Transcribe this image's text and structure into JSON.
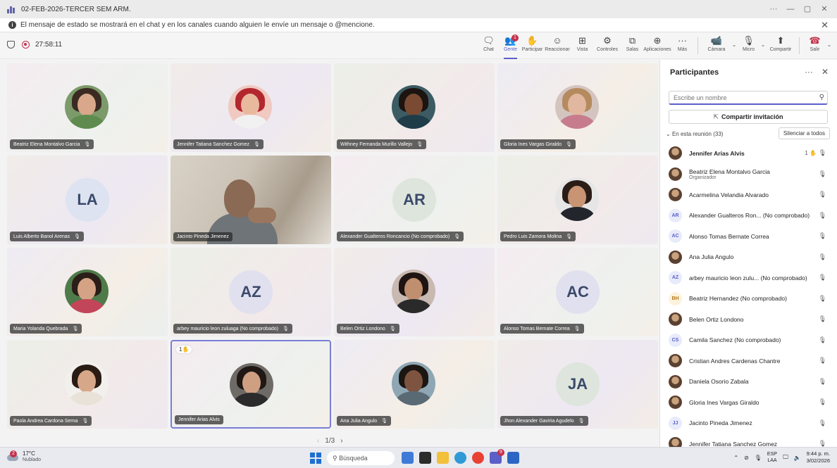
{
  "window": {
    "title": "02-FEB-2026-TERCER SEM ARM."
  },
  "banner": {
    "text": "El mensaje de estado se mostrará en el chat y en los canales cuando alguien le envíe un mensaje o @mencione."
  },
  "meeting": {
    "timer": "27:58:11"
  },
  "toolbar": {
    "chat": "Chat",
    "people": "Gente",
    "people_badge": "1",
    "join": "Participar",
    "react": "Reaccionar",
    "view": "Vista",
    "controls": "Controles",
    "rooms": "Salas",
    "apps": "Aplicaciones",
    "more": "Más",
    "camera": "Cámara",
    "mic": "Micro",
    "share": "Compartir",
    "leave": "Salir"
  },
  "tiles": [
    {
      "name": "Beatriz Elena Montalvo Garcia",
      "type": "photo"
    },
    {
      "name": "Jennifer Tatiana Sanchez Gomez",
      "type": "photo"
    },
    {
      "name": "Withney Fernanda Murillo Vallejo",
      "type": "photo"
    },
    {
      "name": "Gloria Ines Vargas Giraldo",
      "type": "photo"
    },
    {
      "name": "Luis Alberto Banol Arenas",
      "type": "initials",
      "initials": "LA"
    },
    {
      "name": "Jacinto Pineda Jimenez",
      "type": "video"
    },
    {
      "name": "Alexander Gualteros Roncancio (No comprobado)",
      "type": "initials",
      "initials": "AR"
    },
    {
      "name": "Pedro Luis Zamora Molina",
      "type": "photo"
    },
    {
      "name": "Maria Yolanda Quebrada",
      "type": "photo"
    },
    {
      "name": "arbey mauricio leon zuluaga (No comprobado)",
      "type": "initials",
      "initials": "AZ"
    },
    {
      "name": "Belen Ortiz Londono",
      "type": "photo"
    },
    {
      "name": "Alonso Tomas Bernate Correa",
      "type": "initials",
      "initials": "AC"
    },
    {
      "name": "Paola Andrea Cardona Serna",
      "type": "photo"
    },
    {
      "name": "Jennifer Arias Alvis",
      "type": "photo",
      "raise": "1"
    },
    {
      "name": "Ana Julia Angulo",
      "type": "photo"
    },
    {
      "name": "Jhon Alexander Gaviria Agudelo",
      "type": "initials",
      "initials": "JA"
    }
  ],
  "pager": {
    "text": "1/3"
  },
  "panel": {
    "title": "Participantes",
    "search_placeholder": "Escribe un nombre",
    "invite": "Compartir invitación",
    "in_meeting": "En esta reunión (33)",
    "mute_all": "Silenciar a todos",
    "participants": [
      {
        "name": "Jennifer Arias Alvis",
        "avatar": "photo",
        "raise": "1",
        "bold": true
      },
      {
        "name": "Beatriz Elena Montalvo Garcia",
        "role": "Organizador",
        "avatar": "photo"
      },
      {
        "name": "Acarmelina Velandia Alvarado",
        "avatar": "photo"
      },
      {
        "name": "Alexander Gualteros Ron... (No comprobado)",
        "avatar": "AR"
      },
      {
        "name": "Alonso Tomas Bernate Correa",
        "avatar": "AC"
      },
      {
        "name": "Ana Julia Angulo",
        "avatar": "photo"
      },
      {
        "name": "arbey mauricio leon zulu... (No comprobado)",
        "avatar": "AZ"
      },
      {
        "name": "Beatriz Hernandez (No comprobado)",
        "avatar": "BH"
      },
      {
        "name": "Belen Ortiz Londono",
        "avatar": "photo"
      },
      {
        "name": "Camila Sanchez (No comprobado)",
        "avatar": "CS"
      },
      {
        "name": "Cristian Andres Cardenas Chantre",
        "avatar": "photo"
      },
      {
        "name": "Daniela Osorio Zabala",
        "avatar": "photo"
      },
      {
        "name": "Gloria Ines Vargas Giraldo",
        "avatar": "photo"
      },
      {
        "name": "Jacinto Pineda Jimenez",
        "avatar": "JJ"
      },
      {
        "name": "Jennifer Tatiana Sanchez Gomez",
        "avatar": "photo"
      }
    ]
  },
  "taskbar": {
    "weather_temp": "17°C",
    "weather_desc": "Nublado",
    "weather_badge": "2",
    "search": "Búsqueda",
    "lang1": "ESP",
    "lang2": "LAA",
    "time": "9:44 p. m.",
    "date": "3/02/2026",
    "teams_badge": "9"
  }
}
